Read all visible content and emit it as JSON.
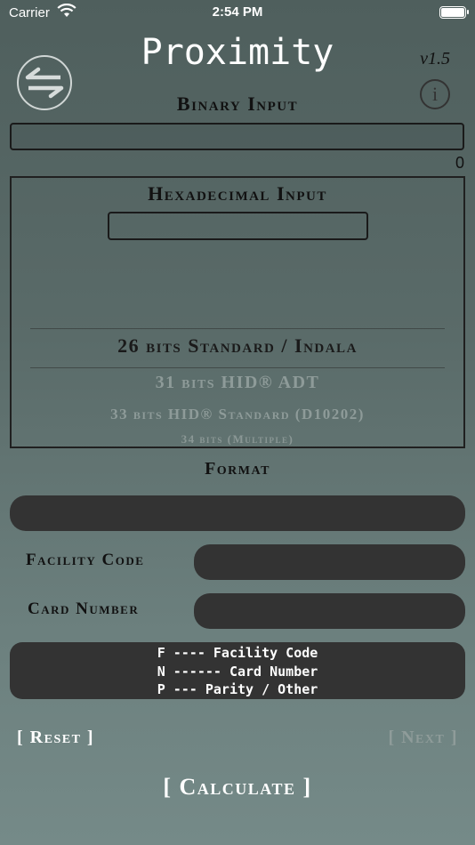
{
  "status": {
    "carrier": "Carrier",
    "time": "2:54 PM"
  },
  "header": {
    "title": "Proximity",
    "version": "v1.5",
    "info_symbol": "i"
  },
  "binary": {
    "title": "Binary Input",
    "value": "",
    "count": "0"
  },
  "hex": {
    "title": "Hexadecimal Input",
    "value": ""
  },
  "picker": {
    "items": [
      "26 bits Standard / Indala",
      "31 bits HID® ADT",
      "33 bits HID® Standard (D10202)",
      "34 bits (Multiple)"
    ],
    "selected": "26 bits Standard / Indala"
  },
  "format": {
    "title": "Format",
    "value": ""
  },
  "facility": {
    "label": "Facility Code",
    "value": ""
  },
  "card": {
    "label": "Card Number",
    "value": ""
  },
  "legend": {
    "line1": "F ---- Facility Code",
    "line2": "N ------ Card Number",
    "line3": "P --- Parity / Other"
  },
  "buttons": {
    "reset": "[ Reset ]",
    "next": "[ Next ]",
    "calculate": "[ Calculate ]"
  },
  "icons": {
    "wifi": "wifi-icon",
    "battery": "battery-icon",
    "info": "info-icon",
    "swap": "swap-arrows-icon"
  }
}
